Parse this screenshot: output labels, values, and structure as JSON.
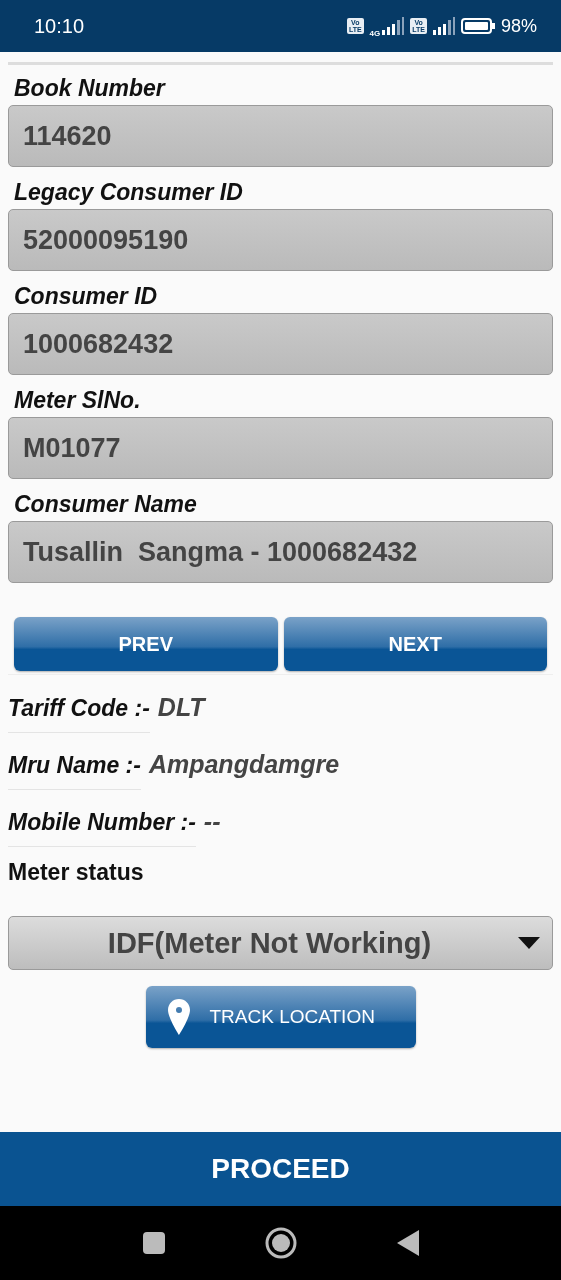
{
  "status_bar": {
    "time": "10:10",
    "sims": [
      {
        "badge_top": "Vo",
        "badge_bottom": "LTE",
        "network": "4G"
      },
      {
        "badge_top": "Vo",
        "badge_bottom": "LTE"
      }
    ],
    "battery": "98%"
  },
  "fields": [
    {
      "label": "Book Number",
      "value": "114620"
    },
    {
      "label": "Legacy Consumer ID",
      "value": "52000095190"
    },
    {
      "label": "Consumer ID",
      "value": "1000682432"
    },
    {
      "label": "Meter SlNo.",
      "value": "M01077"
    },
    {
      "label": "Consumer Name",
      "value": "Tusallin  Sangma - 1000682432"
    }
  ],
  "nav_buttons": [
    "PREV",
    "NEXT"
  ],
  "info": [
    {
      "label": "Tariff Code :-",
      "value": "DLT"
    },
    {
      "label": "Mru Name :-",
      "value": "Ampangdamgre"
    },
    {
      "label": "Mobile Number :-",
      "value": "--"
    }
  ],
  "meter_status": {
    "label": "Meter status",
    "value": "IDF(Meter Not Working)"
  },
  "track_button": "TRACK LOCATION",
  "proceed_button": "PROCEED"
}
